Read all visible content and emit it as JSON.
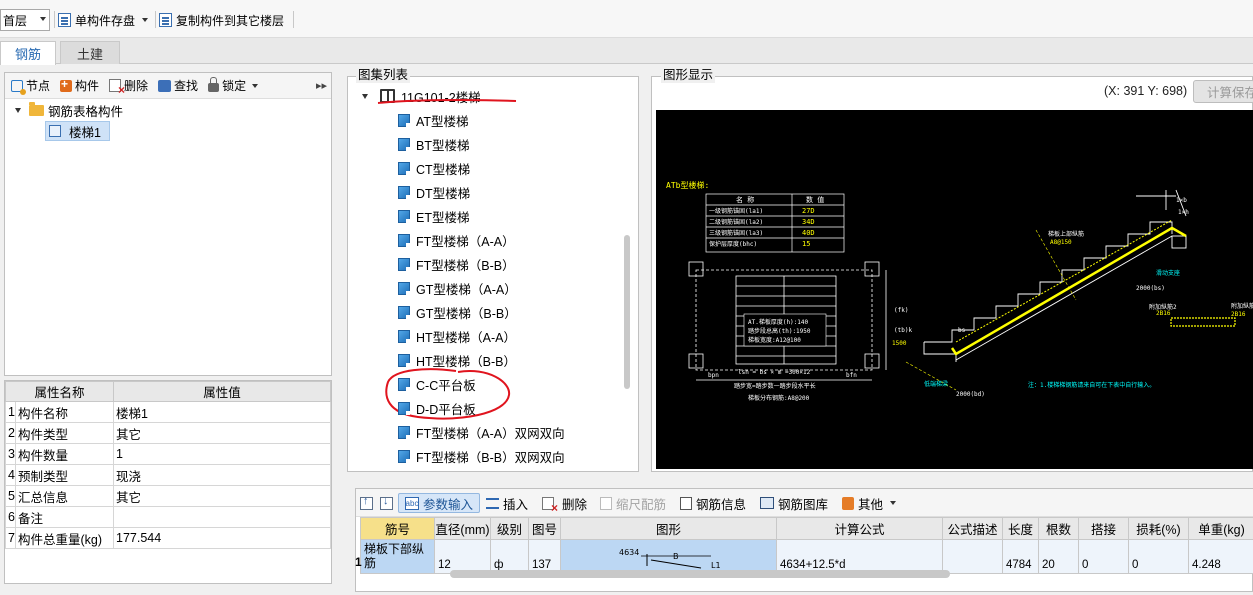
{
  "toolbar": {
    "floor": "首层",
    "save_label": "单构件存盘",
    "copy_label": "复制构件到其它楼层"
  },
  "tabs": [
    {
      "label": "钢筋"
    },
    {
      "label": "土建"
    }
  ],
  "left_toolbar": {
    "node": "节点",
    "component": "构件",
    "delete": "删除",
    "find": "查找",
    "lock": "锁定"
  },
  "tree": {
    "root": "钢筋表格构件",
    "child": "楼梯1"
  },
  "properties": {
    "header_name": "属性名称",
    "header_value": "属性值",
    "rows": [
      {
        "num": "1",
        "name": "构件名称",
        "value": "楼梯1"
      },
      {
        "num": "2",
        "name": "构件类型",
        "value": "其它"
      },
      {
        "num": "3",
        "name": "构件数量",
        "value": "1"
      },
      {
        "num": "4",
        "name": "预制类型",
        "value": "现浇"
      },
      {
        "num": "5",
        "name": "汇总信息",
        "value": "其它"
      },
      {
        "num": "6",
        "name": "备注",
        "value": ""
      },
      {
        "num": "7",
        "name": "构件总重量(kg)",
        "value": "177.544"
      }
    ]
  },
  "atlas": {
    "label": "图集列表",
    "root": "11G101-2楼梯",
    "items": [
      "AT型楼梯",
      "BT型楼梯",
      "CT型楼梯",
      "DT型楼梯",
      "ET型楼梯",
      "FT型楼梯（A-A）",
      "FT型楼梯（B-B）",
      "GT型楼梯（A-A）",
      "GT型楼梯（B-B）",
      "HT型楼梯（A-A）",
      "HT型楼梯（B-B）",
      "C-C平台板",
      "D-D平台板",
      "FT型楼梯（A-A）双网双向",
      "FT型楼梯（B-B）双网双向"
    ]
  },
  "graph": {
    "label": "图形显示",
    "coords": "(X: 391 Y: 698)",
    "calc_button": "计算保存",
    "drawing": {
      "title": "ATb型楼梯:",
      "table_headers": [
        "名 称",
        "数 值"
      ],
      "table_rows": [
        [
          "一级钢筋锚固(la1)",
          "27D"
        ],
        [
          "二级钢筋锚固(la2)",
          "34D"
        ],
        [
          "三级钢筋锚固(la3)",
          "40D"
        ],
        [
          "保护层厚度(bhc)",
          "15"
        ]
      ],
      "note1": "AT.梯板厚度(h):140",
      "note2": "踏步段总高(th):1950",
      "note3": "梯板宽度:A12@100",
      "dims": [
        "bpn",
        "lsn = bs × m =300×12",
        "bfn",
        "(fk)",
        "(tb)k",
        "1500"
      ],
      "bottom1": "踏步宽=踏步数一踏步段水平长",
      "bottom2": "梯板分布钢筋:A8@200",
      "label_top": "梯板上部纵筋",
      "label_top_val": "A8@150",
      "label_support1": "滑动支座",
      "label_bs": "2000(bs)",
      "label_side": "附加纵筋2",
      "label_side_val": "2B16",
      "label_ext": "附加纵筋1",
      "label_ext_val": "2B16",
      "label_bottom": "低端梯梁",
      "label_bd": "2000(bd)",
      "note_bottom": "注：1.楼梯梯钢筋请来自可在下表中自行输入。",
      "label_1b": "1×b",
      "label_1h": "1×h",
      "label_bs2": "bs"
    }
  },
  "bottom_toolbar": {
    "param_input": "参数输入",
    "insert": "插入",
    "delete": "删除",
    "scale_rebar": "缩尺配筋",
    "rebar_info": "钢筋信息",
    "rebar_lib": "钢筋图库",
    "other": "其他"
  },
  "rebar_table": {
    "headers": [
      "筋号",
      "直径(mm)",
      "级别",
      "图号",
      "图形",
      "计算公式",
      "公式描述",
      "长度",
      "根数",
      "搭接",
      "损耗(%)",
      "单重(kg)"
    ],
    "row_num": "1",
    "row": {
      "name": "梯板下部纵筋",
      "diameter": "12",
      "grade": "ф",
      "fig_no": "137",
      "shape_left": "4634",
      "shape_mid": "B",
      "shape_right": "L1",
      "formula": "4634+12.5*d",
      "desc": "",
      "length": "4784",
      "count": "20",
      "lap": "0",
      "loss": "0",
      "unit_weight": "4.248"
    }
  },
  "colors": {
    "accent_blue": "#2b6cb3",
    "selection": "#cfe2f7",
    "annotation_red": "#e0141e",
    "cad_yellow": "#ffff00"
  }
}
